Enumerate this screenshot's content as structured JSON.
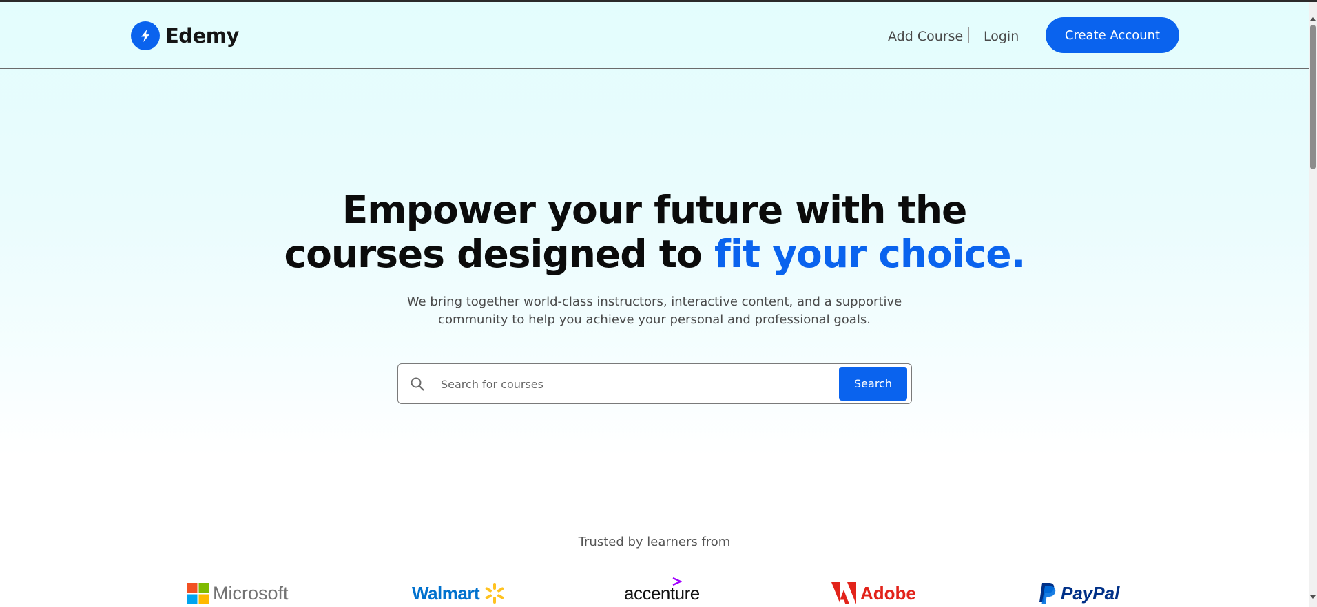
{
  "header": {
    "brand": "Edemy",
    "nav": {
      "add_course": "Add Course",
      "login": "Login",
      "create_account": "Create Account"
    }
  },
  "hero": {
    "title_line1": "Empower your future with the",
    "title_line2_start": "courses designed to ",
    "title_line2_accent": "fit your choice.",
    "subtitle_line1": "We bring together world-class instructors, interactive content, and a supportive",
    "subtitle_line2": "community to help you achieve your personal and professional goals."
  },
  "search": {
    "placeholder": "Search for courses",
    "value": "",
    "button_label": "Search"
  },
  "trusted": {
    "heading": "Trusted by learners from",
    "brands": [
      "Microsoft",
      "Walmart",
      "accenture",
      "Adobe",
      "PayPal"
    ]
  },
  "colors": {
    "accent": "#0a63ee",
    "background_top": "#e3fdfd",
    "text_dark": "#0b0b0b"
  },
  "icons": {
    "logo": "lightning-bolt-icon",
    "search": "search-icon"
  }
}
